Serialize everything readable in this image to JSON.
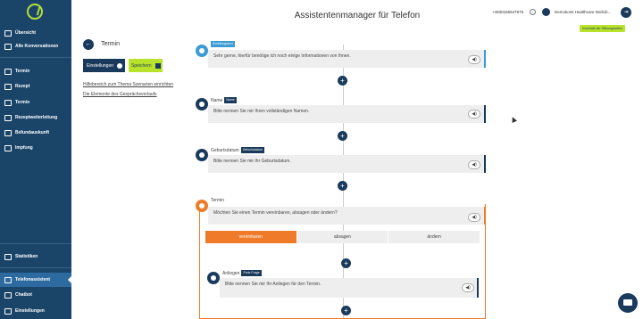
{
  "sidebar": {
    "items": [
      {
        "label": "Übersicht",
        "icon": "grid-icon"
      },
      {
        "label": "Alle Konversationen",
        "icon": "conversations-icon"
      },
      {
        "label": "Termin",
        "icon": "chat-icon"
      },
      {
        "label": "Rezept",
        "icon": "chat-icon"
      },
      {
        "label": "Termin",
        "icon": "phone-icon"
      },
      {
        "label": "Rezeptweiterleitung",
        "icon": "phone-icon"
      },
      {
        "label": "Befundauskunft",
        "icon": "phone-icon"
      },
      {
        "label": "Impfung",
        "icon": "phone-icon"
      },
      {
        "label": "Statistiken",
        "icon": "chart-icon"
      },
      {
        "label": "Telefonassistent",
        "icon": "cloud-icon"
      },
      {
        "label": "Chatbot",
        "icon": "bot-icon"
      },
      {
        "label": "Einstellungen",
        "icon": "settings-icon"
      }
    ]
  },
  "header": {
    "title": "Assistentenmanager für Telefon",
    "phone": "+4930166547675",
    "org": "Demokonti Healthcare Wolloh...",
    "opening_badge": "Innerhalb der Öffnungszeiten"
  },
  "panel": {
    "section_title": "Termin",
    "settings_button": "Einstellungen",
    "save_button": "Speichern",
    "link1": "Hilfebereich zum Thema Szenarien einrichten",
    "link2": "Die Elemente des Gesprächsverlaufs"
  },
  "blocks": [
    {
      "name": "",
      "tag": "Einleitungstext",
      "text": "Sehr gerne, hierfür benötige ich noch einige Informationen von Ihnen."
    },
    {
      "name": "Name",
      "tag": "Name",
      "text": "Bitte nennen Sie mir Ihren vollständigen Namen."
    },
    {
      "name": "Geburtsdatum",
      "tag": "Geburtsdatum",
      "text": "Bitte nennen Sie mir Ihr Geburtsdatum."
    },
    {
      "name": "Termin",
      "tag": "",
      "text": "Möchten Sie einen Termin vereinbaren, absagen oder ändern?"
    },
    {
      "name": "Anliegen",
      "tag": "Freie Frage",
      "text": "Bitte nennen Sie mir Ihr Anliegen für den Termin."
    }
  ],
  "tabs": [
    "vereinbaren",
    "absagen",
    "ändern"
  ],
  "icons": {
    "plus": "+",
    "sound": "◀)",
    "back": "←",
    "logout": "⇥"
  }
}
